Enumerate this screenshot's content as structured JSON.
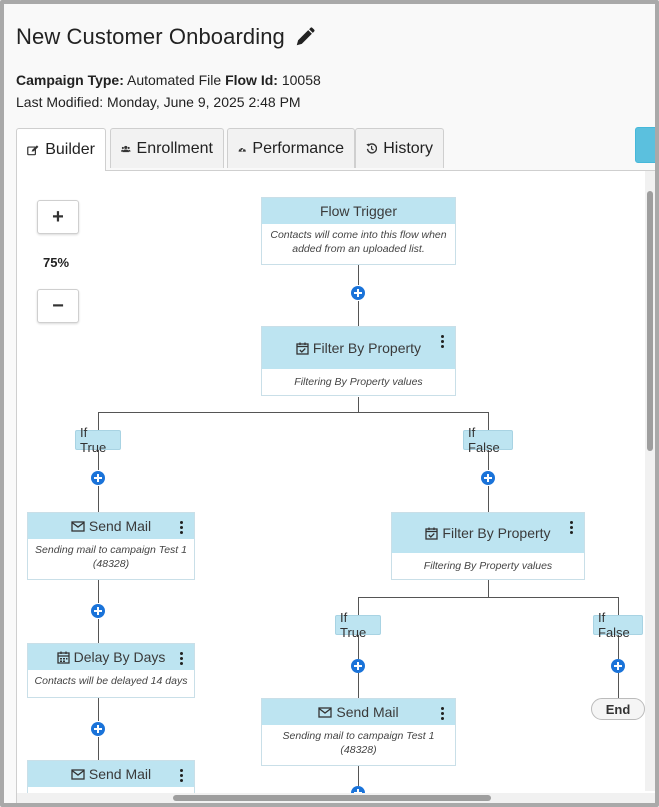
{
  "page": {
    "title": "New Customer Onboarding",
    "campaign_type_label": "Campaign Type:",
    "campaign_type_value": "Automated File",
    "flow_id_label": "Flow Id:",
    "flow_id_value": "10058",
    "last_modified": "Last Modified: Monday, June 9, 2025 2:48 PM"
  },
  "tabs": [
    {
      "label": "Builder",
      "icon": "edit-icon"
    },
    {
      "label": "Enrollment",
      "icon": "users-icon"
    },
    {
      "label": "Performance",
      "icon": "dashboard-icon"
    },
    {
      "label": "History",
      "icon": "history-icon"
    }
  ],
  "zoom": {
    "plus": "+",
    "minus": "−",
    "level": "75%"
  },
  "flow": {
    "trigger": {
      "title": "Flow Trigger",
      "body": "Contacts will come into this flow when added from an uploaded list."
    },
    "filter1": {
      "title": "Filter By Property",
      "body": "Filtering By Property values"
    },
    "if_true": "If True",
    "if_false": "If False",
    "send_mail_1": {
      "title": "Send Mail",
      "body": "Sending mail to campaign Test 1 (48328)"
    },
    "delay": {
      "title": "Delay By Days",
      "body": "Contacts will be delayed 14 days"
    },
    "send_mail_2": {
      "title": "Send Mail"
    },
    "filter2": {
      "title": "Filter By Property",
      "body": "Filtering By Property values"
    },
    "if_true_2": "If True",
    "if_false_2": "If False",
    "send_mail_3": {
      "title": "Send Mail",
      "body": "Sending mail to campaign Test 1 (48328)"
    },
    "end": "End"
  },
  "colors": {
    "node_header": "#bde4f1",
    "plus": "#1a73d9",
    "accent_button": "#5bc0de"
  }
}
